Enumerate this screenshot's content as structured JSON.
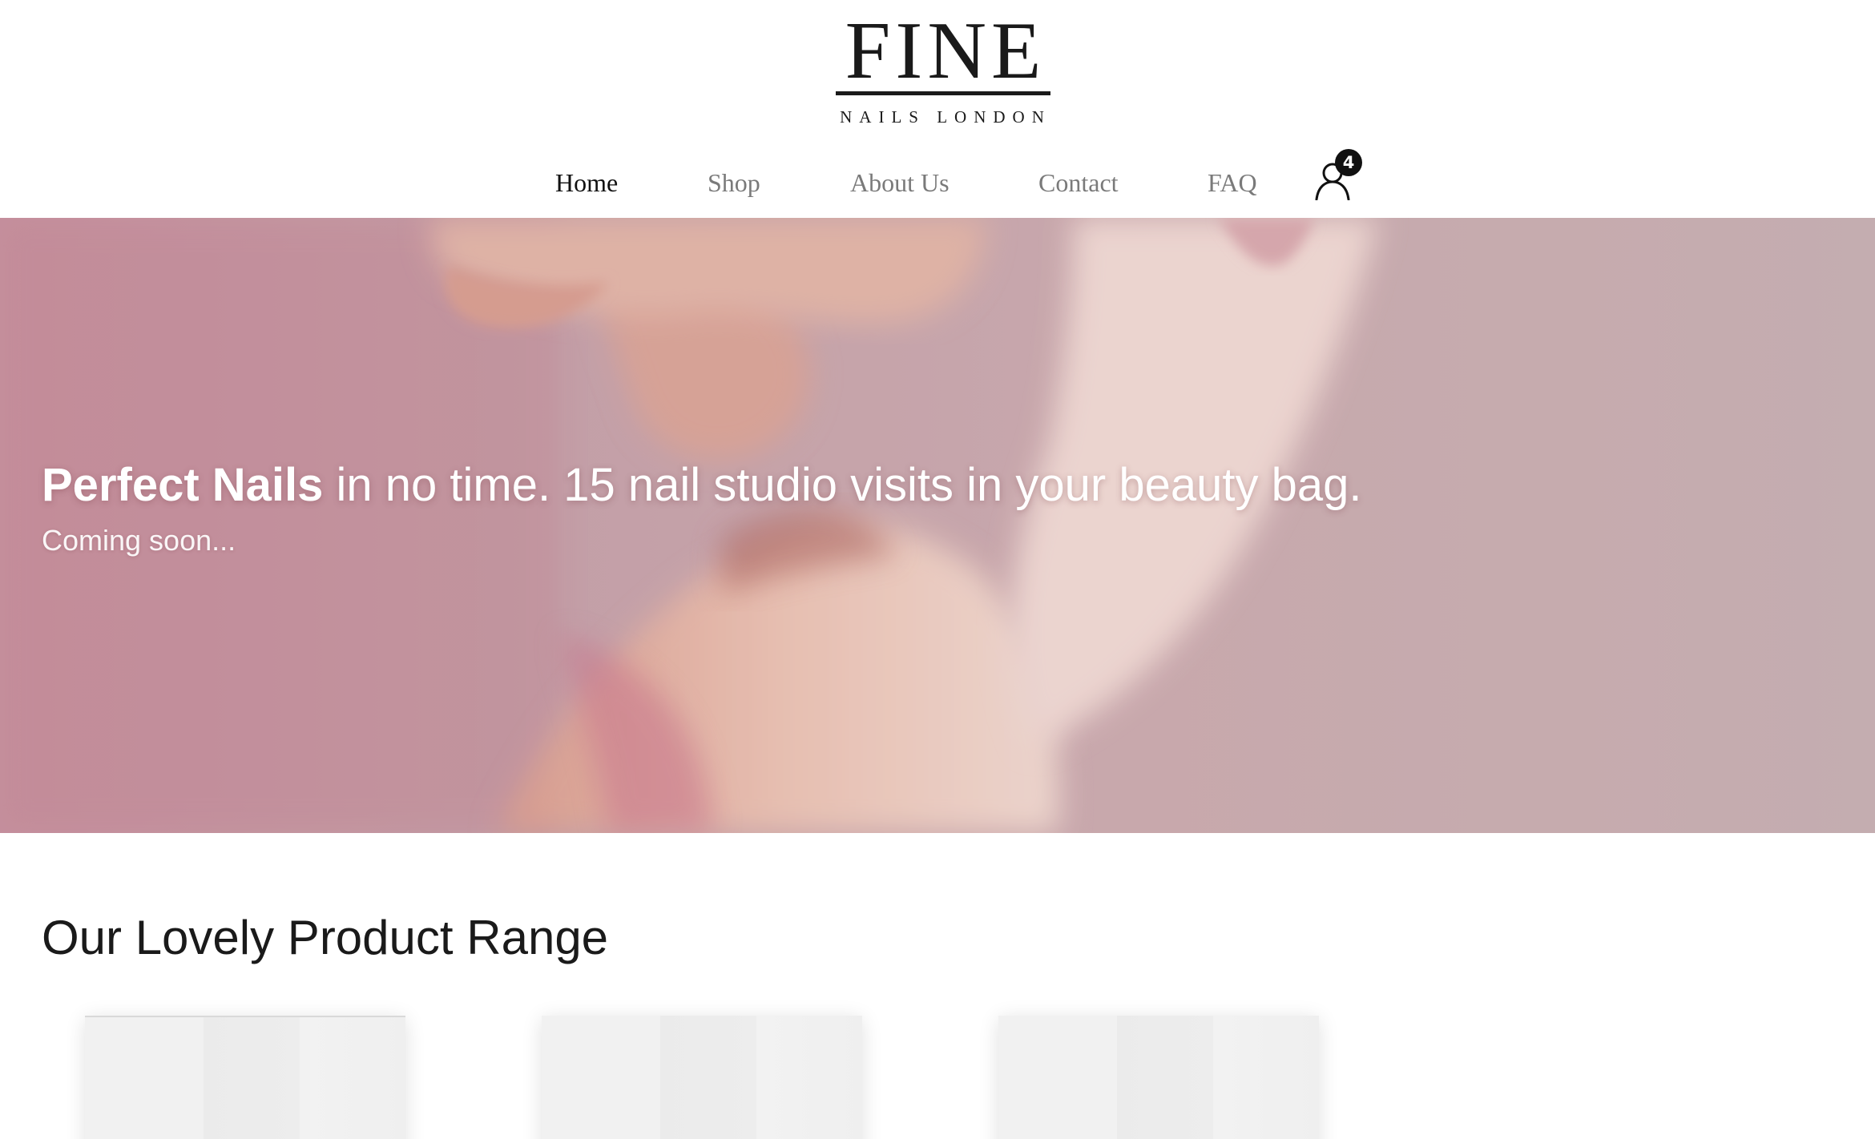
{
  "brand": {
    "name": "FINE",
    "tagline": "NAILS LONDON"
  },
  "nav": {
    "items": [
      {
        "label": "Home",
        "active": true
      },
      {
        "label": "Shop",
        "active": false
      },
      {
        "label": "About Us",
        "active": false
      },
      {
        "label": "Contact",
        "active": false
      },
      {
        "label": "FAQ",
        "active": false
      }
    ],
    "account_icon": "user-icon",
    "badge_count": "4"
  },
  "hero": {
    "headline_strong": "Perfect Nails",
    "headline_rest": " in no time. 15 nail studio visits in your beauty bag.",
    "subtext": "Coming soon..."
  },
  "products": {
    "title": "Our Lovely Product Range",
    "cards_visible": 3
  },
  "colors": {
    "text_dark": "#1a1a1a",
    "nav_inactive": "#7a7a7a",
    "hero_pink": "#c3a0a8",
    "badge": "#111111"
  }
}
